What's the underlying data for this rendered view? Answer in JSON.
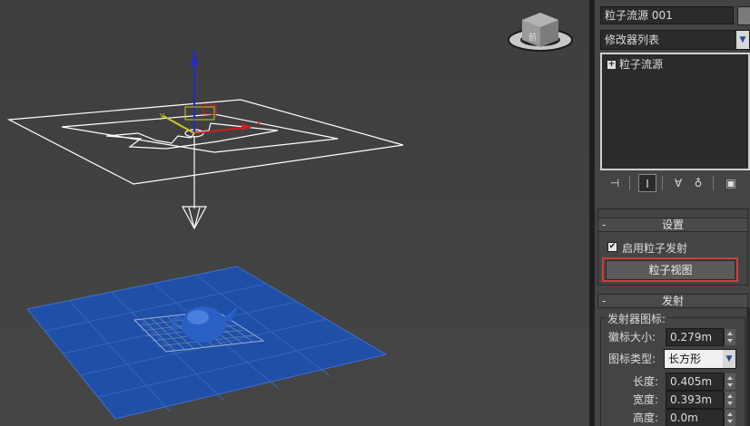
{
  "viewport": {
    "name": "perspective-viewport",
    "viewcube_label": "前"
  },
  "panel": {
    "object_name": "粒子流源 001",
    "color_swatch": "#7a7a7a",
    "modifier_list": "修改器列表",
    "stack_items": [
      {
        "label": "粒子流源"
      }
    ],
    "toolbar": [
      {
        "icon": "pin-stack-icon"
      },
      {
        "icon": "show-end-result-icon",
        "active": true
      },
      {
        "icon": "make-unique-icon"
      },
      {
        "icon": "remove-modifier-icon"
      },
      {
        "icon": "configure-modifier-sets-icon"
      }
    ],
    "settings": {
      "title": "设置",
      "enable_label": "启用粒子发射",
      "enable_checked": true,
      "particle_view_button": "粒子视图"
    },
    "emission": {
      "title": "发射",
      "icon_group": "发射器图标:",
      "logo_size_label": "徽标大小:",
      "logo_size_value": "0.279m",
      "icon_type_label": "图标类型:",
      "icon_type_value": "长方形",
      "length_label": "长度:",
      "length_value": "0.405m",
      "width_label": "宽度:",
      "width_value": "0.393m",
      "height_label": "高度:",
      "height_value": "0.0m"
    },
    "highlight_color": "#d23b3b"
  }
}
